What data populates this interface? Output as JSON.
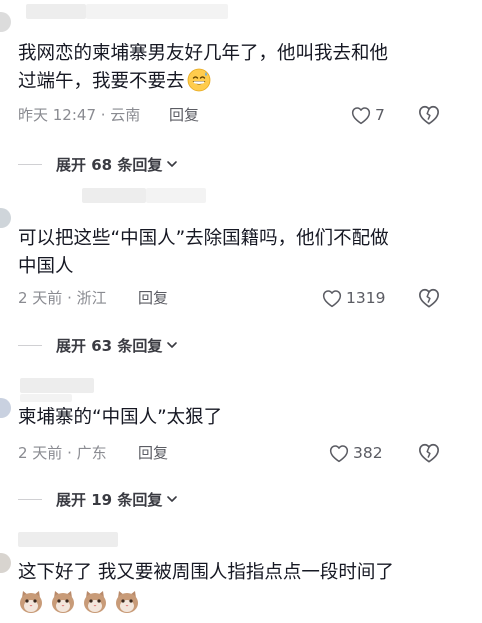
{
  "comments": [
    {
      "text_line1": "我网恋的柬埔寨男友好几年了，他叫我去和他",
      "text_line2": "过端午，我要不要去",
      "time_location": "昨天 12:47 · 云南",
      "reply_label": "回复",
      "likes": "7",
      "expand_label": "展开 68 条回复"
    },
    {
      "text_line1": "可以把这些“中国人”去除国籍吗，他们不配做",
      "text_line2": "中国人",
      "time_location": "2 天前 · 浙江",
      "reply_label": "回复",
      "likes": "1319",
      "expand_label": "展开 63 条回复"
    },
    {
      "text_line1": "柬埔寨的“中国人”太狠了",
      "time_location": "2 天前 · 广东",
      "reply_label": "回复",
      "likes": "382",
      "expand_label": "展开 19 条回复"
    },
    {
      "text_line1": "这下好了 我又要被周围人指指点点一段时间了"
    }
  ],
  "icons": {
    "like": "heart-outline-icon",
    "dislike": "broken-heart-icon",
    "expand": "chevron-down-icon",
    "emoji_1": "grinning-sweat-emoji",
    "emoji_4": "cat-face-emoji"
  },
  "colors": {
    "text": "#161823",
    "meta": "#8a8b91",
    "action": "#5b5c63"
  }
}
